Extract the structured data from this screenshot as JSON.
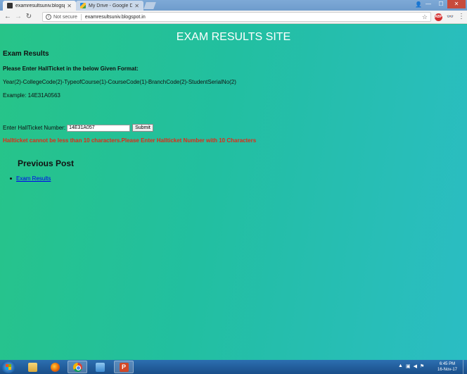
{
  "browser": {
    "tabs": [
      {
        "title": "examresultsuniv.blogspot",
        "active": true
      },
      {
        "title": "My Drive - Google Drive",
        "active": false
      }
    ],
    "security_label": "Not secure",
    "url": "examresultsuniv.blogspot.in"
  },
  "page": {
    "site_title": "EXAM RESULTS SITE",
    "heading": "Exam Results",
    "instruction": "Please Enter HallTicket in the below Given Format:",
    "format": "Year(2)-CollegeCode(2)-TypeofCourse(1)-CourseCode(1)-BranchCode(2)-StudentSerialNo(2)",
    "example": "Example: 14E31A0563",
    "input_label": "Enter HallTicket Number:",
    "input_value": "14E31A057",
    "submit_label": "Submit",
    "error_message": "Hallticket cannot be less than 10 characters.Please Enter Hallticket Number with 10 Characters",
    "previous_post_heading": "Previous Post",
    "previous_posts": [
      "Exam Results"
    ]
  },
  "taskbar": {
    "time": "6:45 PM",
    "date": "16-Nov-17"
  },
  "colors": {
    "error": "#e12a16",
    "link": "#0000ee",
    "page_gradient_start": "#27c488",
    "page_gradient_end": "#2bbdc4"
  }
}
